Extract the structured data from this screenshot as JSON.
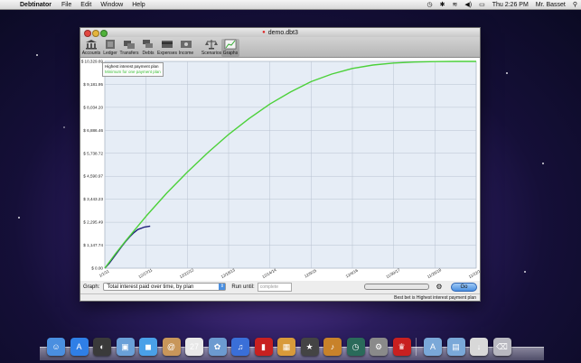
{
  "menubar": {
    "apple": "",
    "app_name": "Debtinator",
    "items": [
      "File",
      "Edit",
      "Window",
      "Help"
    ],
    "clock": "Thu 2:26 PM",
    "user": "Mr. Basset"
  },
  "window": {
    "title": "demo.dbt3",
    "toolbar": [
      {
        "label": "Accounts",
        "icon": "bank-icon"
      },
      {
        "label": "Ledger",
        "icon": "ledger-icon"
      },
      {
        "label": "Transfers",
        "icon": "transfer-icon"
      },
      {
        "label": "Debts",
        "icon": "debts-icon"
      },
      {
        "label": "Expenses",
        "icon": "expenses-icon"
      },
      {
        "label": "Income",
        "icon": "income-icon"
      },
      {
        "label": "Scenarios",
        "icon": "scales-icon"
      },
      {
        "label": "Graphs",
        "icon": "graph-icon",
        "selected": true
      }
    ]
  },
  "tooltip": {
    "line1": "Highest interest payment plan",
    "line2": "Minimum for one payment plan"
  },
  "chart_data": {
    "type": "line",
    "ylim": [
      0,
      10329.69
    ],
    "y_ticks": [
      "$ 0.00",
      "$ 1,147.74",
      "$ 2,295.49",
      "$ 3,443.23",
      "$ 4,590.97",
      "$ 5,738.72",
      "$ 6,886.46",
      "$ 8,034.20",
      "$ 9,181.95",
      "$ 10,329.69"
    ],
    "x_ticks": [
      "1/1/11",
      "12/27/11",
      "12/22/12",
      "12/18/13",
      "12/14/14",
      "12/9/15",
      "12/4/16",
      "11/30/17",
      "11/26/18",
      "11/22/19"
    ],
    "series": [
      {
        "name": "Highest interest payment plan",
        "color": "#1f1f7a",
        "x": [
          0,
          0.1,
          0.2,
          0.3,
          0.4,
          0.5,
          0.6,
          0.7,
          0.8,
          0.95,
          1.1
        ],
        "y": [
          0,
          230,
          500,
          780,
          1060,
          1320,
          1560,
          1770,
          1930,
          2050,
          2100
        ]
      },
      {
        "name": "Minimum for one payment plan",
        "color": "#4cd13a",
        "x": [
          0,
          0.25,
          0.5,
          1,
          1.5,
          2,
          2.5,
          3,
          3.5,
          4,
          4.5,
          5,
          5.5,
          6,
          6.5,
          7,
          7.5,
          8,
          8.5,
          9
        ],
        "y": [
          0,
          700,
          1350,
          2600,
          3750,
          4800,
          5780,
          6680,
          7480,
          8200,
          8800,
          9320,
          9700,
          9980,
          10150,
          10250,
          10300,
          10320,
          10328,
          10329.69
        ]
      }
    ]
  },
  "controls": {
    "graph_label": "Graph:",
    "graph_value": "Total interest paid over time, by plan",
    "run_until_label": "Run until:",
    "run_until_placeholder": "complete",
    "go_label": "Go"
  },
  "status": "Best bet is Highest interest payment plan",
  "dock": [
    {
      "name": "finder-icon",
      "color": "#4a8fe0",
      "glyph": "☺"
    },
    {
      "name": "app-store-icon",
      "color": "#2f7fe6",
      "glyph": "A"
    },
    {
      "name": "dashboard-icon",
      "color": "#3a3a3a",
      "glyph": "◐"
    },
    {
      "name": "preview-icon",
      "color": "#6aa0d8",
      "glyph": "▣"
    },
    {
      "name": "facetime-icon",
      "color": "#4aa0e8",
      "glyph": "◼"
    },
    {
      "name": "address-book-icon",
      "color": "#c8965a",
      "glyph": "@"
    },
    {
      "name": "ical-icon",
      "color": "#e8e8e8",
      "glyph": "27"
    },
    {
      "name": "iphoto-icon",
      "color": "#6c9ad0",
      "glyph": "✿"
    },
    {
      "name": "itunes-icon",
      "color": "#3a6fd8",
      "glyph": "♫"
    },
    {
      "name": "photo-booth-icon",
      "color": "#c82020",
      "glyph": "▮"
    },
    {
      "name": "iphoto-library-icon",
      "color": "#d89a3a",
      "glyph": "▦"
    },
    {
      "name": "imovie-icon",
      "color": "#444",
      "glyph": "★"
    },
    {
      "name": "garageband-icon",
      "color": "#c8822a",
      "glyph": "♪"
    },
    {
      "name": "time-machine-icon",
      "color": "#2a6a5a",
      "glyph": "◷"
    },
    {
      "name": "system-preferences-icon",
      "color": "#8a8a8a",
      "glyph": "⚙"
    },
    {
      "name": "debtinator-icon",
      "color": "#c82020",
      "glyph": "♛"
    },
    {
      "name": "sep",
      "color": "",
      "glyph": ""
    },
    {
      "name": "applications-folder-icon",
      "color": "#7aa8d8",
      "glyph": "A"
    },
    {
      "name": "documents-folder-icon",
      "color": "#7aa8d8",
      "glyph": "▤"
    },
    {
      "name": "downloads-folder-icon",
      "color": "#d8d8d8",
      "glyph": "↓"
    },
    {
      "name": "trash-icon",
      "color": "#b8b8c0",
      "glyph": "⌫"
    }
  ]
}
